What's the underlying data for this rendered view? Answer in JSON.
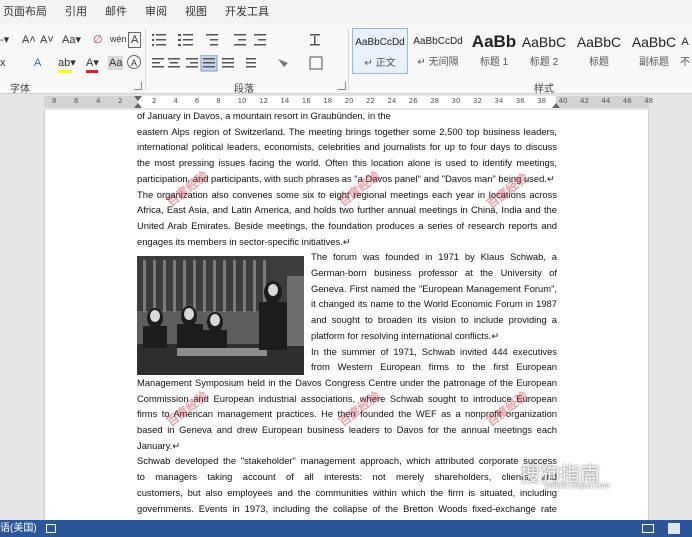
{
  "menu_tabs": [
    "页面布局",
    "引用",
    "邮件",
    "审阅",
    "视图",
    "开发工具"
  ],
  "ribbon": {
    "groups": {
      "font": "字体",
      "paragraph": "段落",
      "styles": "样式"
    },
    "font_buttons": {
      "grow": "A˄",
      "shrink": "A˅",
      "case": "Aa▾",
      "clear": "∅",
      "phonetic": "wén",
      "bold_a": "A",
      "highlight": "ab▾",
      "color": "A▾",
      "aa": "Aa",
      "circle": "A"
    },
    "style_items": [
      {
        "preview": "AaBbCcDd",
        "name": "↵ 正文"
      },
      {
        "preview": "AaBbCcDd",
        "name": "↵ 无间隔"
      },
      {
        "preview": "AaBb",
        "name": "标题 1"
      },
      {
        "preview": "AaBbC",
        "name": "标题 2"
      },
      {
        "preview": "AaBbC",
        "name": "标题"
      },
      {
        "preview": "AaBbC",
        "name": "副标题"
      },
      {
        "preview": "A",
        "name": "不"
      }
    ]
  },
  "ruler": {
    "left_numbers": [
      "8",
      "6",
      "4",
      "2"
    ],
    "right_numbers": [
      "2",
      "4",
      "6",
      "8",
      "10",
      "12",
      "14",
      "16",
      "18",
      "20",
      "22",
      "24",
      "26",
      "28",
      "30",
      "32",
      "34",
      "36",
      "38",
      "40",
      "42",
      "44",
      "46",
      "48"
    ]
  },
  "document": {
    "para1": [
      "of January in Davos, a mountain resort in Graubünden, in the",
      "eastern Alps region of Switzerland. The meeting brings together some 2,500 top business leaders,",
      "international political leaders, economists, celebrities and journalists for up to four days to discuss",
      "the most pressing issues facing the world. Often this location alone is used to identify meetings,",
      "participation, and participants, with such phrases as \"a Davos panel\" and \"Davos man\" being used.↵",
      "The organization also convenes some six to eight regional meetings each year in locations across",
      "Africa, East Asia, and Latin America, and holds two further annual meetings in China, India and the",
      "United Arab Emirates. Beside meetings, the foundation produces a series of research reports and",
      "engages its members in sector-specific initiatives.↵"
    ],
    "para2_narrow": [
      "The forum was founded in 1971 by Klaus Schwab, a",
      "German-born business professor at the University of",
      "Geneva. First named the \"European Management Forum\",",
      "it changed its name to the World Economic Forum in 1987",
      "and sought to broaden its vision to include providing a",
      "platform for resolving international conflicts.↵",
      "In the summer of 1971, Schwab invited 444 executives",
      "from Western European firms to the first European"
    ],
    "para3_full": [
      "Management Symposium held in the Davos Congress Centre under the patronage of the European",
      "Commission and European industrial associations, where Schwab sought to introduce European",
      "firms to American management practices. He then founded the WEF as a nonprofit organization",
      "based in Geneva and drew European business leaders to Davos for the annual meetings each",
      "January.↵",
      "Schwab developed the \"stakeholder\" management approach, which attributed corporate success",
      "to managers taking account of all interests: not merely shareholders, clients, and",
      "customers, but also employees and the communities within which the firm is situated, including",
      "governments. Events in 1973, including the collapse of the Bretton Woods fixed-exchange rate"
    ],
    "watermark": "百度经验",
    "logo": "搜狗指南",
    "logo_sub": "zhinan.sogou.com"
  },
  "status_bar": {
    "language": "语(美国)"
  }
}
